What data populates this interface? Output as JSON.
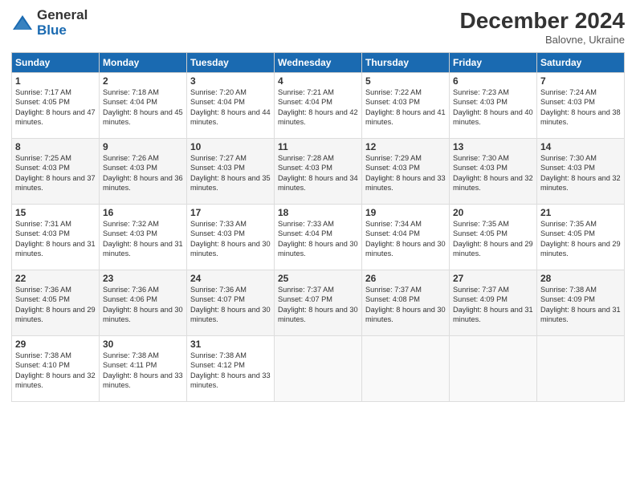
{
  "header": {
    "logo_general": "General",
    "logo_blue": "Blue",
    "month_title": "December 2024",
    "location": "Balovne, Ukraine"
  },
  "days_of_week": [
    "Sunday",
    "Monday",
    "Tuesday",
    "Wednesday",
    "Thursday",
    "Friday",
    "Saturday"
  ],
  "weeks": [
    [
      {
        "day": "1",
        "sunrise": "Sunrise: 7:17 AM",
        "sunset": "Sunset: 4:05 PM",
        "daylight": "Daylight: 8 hours and 47 minutes."
      },
      {
        "day": "2",
        "sunrise": "Sunrise: 7:18 AM",
        "sunset": "Sunset: 4:04 PM",
        "daylight": "Daylight: 8 hours and 45 minutes."
      },
      {
        "day": "3",
        "sunrise": "Sunrise: 7:20 AM",
        "sunset": "Sunset: 4:04 PM",
        "daylight": "Daylight: 8 hours and 44 minutes."
      },
      {
        "day": "4",
        "sunrise": "Sunrise: 7:21 AM",
        "sunset": "Sunset: 4:04 PM",
        "daylight": "Daylight: 8 hours and 42 minutes."
      },
      {
        "day": "5",
        "sunrise": "Sunrise: 7:22 AM",
        "sunset": "Sunset: 4:03 PM",
        "daylight": "Daylight: 8 hours and 41 minutes."
      },
      {
        "day": "6",
        "sunrise": "Sunrise: 7:23 AM",
        "sunset": "Sunset: 4:03 PM",
        "daylight": "Daylight: 8 hours and 40 minutes."
      },
      {
        "day": "7",
        "sunrise": "Sunrise: 7:24 AM",
        "sunset": "Sunset: 4:03 PM",
        "daylight": "Daylight: 8 hours and 38 minutes."
      }
    ],
    [
      {
        "day": "8",
        "sunrise": "Sunrise: 7:25 AM",
        "sunset": "Sunset: 4:03 PM",
        "daylight": "Daylight: 8 hours and 37 minutes."
      },
      {
        "day": "9",
        "sunrise": "Sunrise: 7:26 AM",
        "sunset": "Sunset: 4:03 PM",
        "daylight": "Daylight: 8 hours and 36 minutes."
      },
      {
        "day": "10",
        "sunrise": "Sunrise: 7:27 AM",
        "sunset": "Sunset: 4:03 PM",
        "daylight": "Daylight: 8 hours and 35 minutes."
      },
      {
        "day": "11",
        "sunrise": "Sunrise: 7:28 AM",
        "sunset": "Sunset: 4:03 PM",
        "daylight": "Daylight: 8 hours and 34 minutes."
      },
      {
        "day": "12",
        "sunrise": "Sunrise: 7:29 AM",
        "sunset": "Sunset: 4:03 PM",
        "daylight": "Daylight: 8 hours and 33 minutes."
      },
      {
        "day": "13",
        "sunrise": "Sunrise: 7:30 AM",
        "sunset": "Sunset: 4:03 PM",
        "daylight": "Daylight: 8 hours and 32 minutes."
      },
      {
        "day": "14",
        "sunrise": "Sunrise: 7:30 AM",
        "sunset": "Sunset: 4:03 PM",
        "daylight": "Daylight: 8 hours and 32 minutes."
      }
    ],
    [
      {
        "day": "15",
        "sunrise": "Sunrise: 7:31 AM",
        "sunset": "Sunset: 4:03 PM",
        "daylight": "Daylight: 8 hours and 31 minutes."
      },
      {
        "day": "16",
        "sunrise": "Sunrise: 7:32 AM",
        "sunset": "Sunset: 4:03 PM",
        "daylight": "Daylight: 8 hours and 31 minutes."
      },
      {
        "day": "17",
        "sunrise": "Sunrise: 7:33 AM",
        "sunset": "Sunset: 4:03 PM",
        "daylight": "Daylight: 8 hours and 30 minutes."
      },
      {
        "day": "18",
        "sunrise": "Sunrise: 7:33 AM",
        "sunset": "Sunset: 4:04 PM",
        "daylight": "Daylight: 8 hours and 30 minutes."
      },
      {
        "day": "19",
        "sunrise": "Sunrise: 7:34 AM",
        "sunset": "Sunset: 4:04 PM",
        "daylight": "Daylight: 8 hours and 30 minutes."
      },
      {
        "day": "20",
        "sunrise": "Sunrise: 7:35 AM",
        "sunset": "Sunset: 4:05 PM",
        "daylight": "Daylight: 8 hours and 29 minutes."
      },
      {
        "day": "21",
        "sunrise": "Sunrise: 7:35 AM",
        "sunset": "Sunset: 4:05 PM",
        "daylight": "Daylight: 8 hours and 29 minutes."
      }
    ],
    [
      {
        "day": "22",
        "sunrise": "Sunrise: 7:36 AM",
        "sunset": "Sunset: 4:05 PM",
        "daylight": "Daylight: 8 hours and 29 minutes."
      },
      {
        "day": "23",
        "sunrise": "Sunrise: 7:36 AM",
        "sunset": "Sunset: 4:06 PM",
        "daylight": "Daylight: 8 hours and 30 minutes."
      },
      {
        "day": "24",
        "sunrise": "Sunrise: 7:36 AM",
        "sunset": "Sunset: 4:07 PM",
        "daylight": "Daylight: 8 hours and 30 minutes."
      },
      {
        "day": "25",
        "sunrise": "Sunrise: 7:37 AM",
        "sunset": "Sunset: 4:07 PM",
        "daylight": "Daylight: 8 hours and 30 minutes."
      },
      {
        "day": "26",
        "sunrise": "Sunrise: 7:37 AM",
        "sunset": "Sunset: 4:08 PM",
        "daylight": "Daylight: 8 hours and 30 minutes."
      },
      {
        "day": "27",
        "sunrise": "Sunrise: 7:37 AM",
        "sunset": "Sunset: 4:09 PM",
        "daylight": "Daylight: 8 hours and 31 minutes."
      },
      {
        "day": "28",
        "sunrise": "Sunrise: 7:38 AM",
        "sunset": "Sunset: 4:09 PM",
        "daylight": "Daylight: 8 hours and 31 minutes."
      }
    ],
    [
      {
        "day": "29",
        "sunrise": "Sunrise: 7:38 AM",
        "sunset": "Sunset: 4:10 PM",
        "daylight": "Daylight: 8 hours and 32 minutes."
      },
      {
        "day": "30",
        "sunrise": "Sunrise: 7:38 AM",
        "sunset": "Sunset: 4:11 PM",
        "daylight": "Daylight: 8 hours and 33 minutes."
      },
      {
        "day": "31",
        "sunrise": "Sunrise: 7:38 AM",
        "sunset": "Sunset: 4:12 PM",
        "daylight": "Daylight: 8 hours and 33 minutes."
      },
      null,
      null,
      null,
      null
    ]
  ]
}
